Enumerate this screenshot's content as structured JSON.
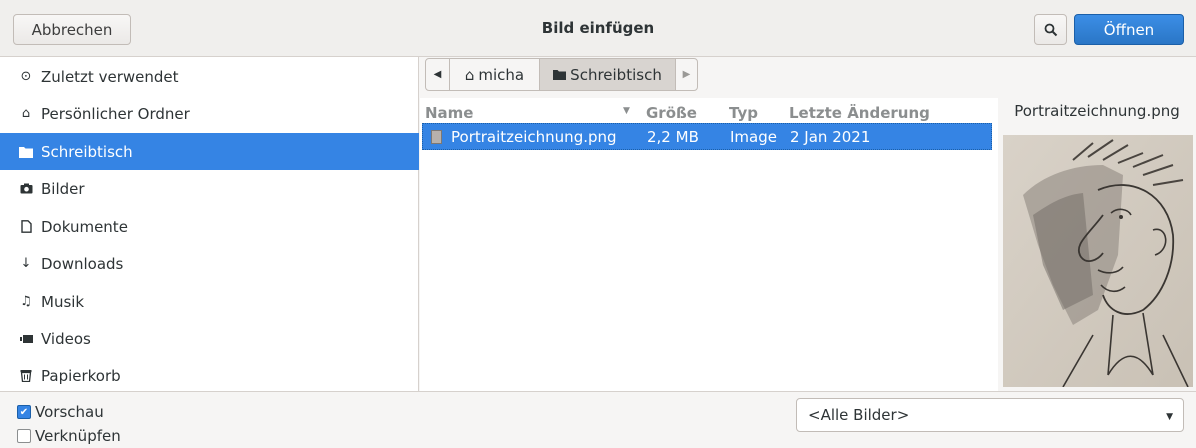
{
  "header": {
    "cancel_label": "Abbrechen",
    "title": "Bild einfügen",
    "open_label": "Öffnen"
  },
  "sidebar": {
    "items": [
      {
        "label": "Zuletzt verwendet",
        "icon": "clock-icon",
        "active": false
      },
      {
        "label": "Persönlicher Ordner",
        "icon": "home-icon",
        "active": false
      },
      {
        "label": "Schreibtisch",
        "icon": "folder-icon",
        "active": true
      },
      {
        "label": "Bilder",
        "icon": "camera-icon",
        "active": false
      },
      {
        "label": "Dokumente",
        "icon": "document-icon",
        "active": false
      },
      {
        "label": "Downloads",
        "icon": "download-icon",
        "active": false
      },
      {
        "label": "Musik",
        "icon": "music-icon",
        "active": false
      },
      {
        "label": "Videos",
        "icon": "video-icon",
        "active": false
      },
      {
        "label": "Papierkorb",
        "icon": "trash-icon",
        "active": false
      }
    ]
  },
  "pathbar": {
    "segments": [
      "micha",
      "Schreibtisch"
    ]
  },
  "filelist": {
    "columns": [
      "Name",
      "Größe",
      "Typ",
      "Letzte Änderung"
    ],
    "rows": [
      {
        "name": "Portraitzeichnung.png",
        "size": "2,2 MB",
        "type": "Image",
        "modified": "2 Jan 2021",
        "selected": true
      }
    ]
  },
  "preview": {
    "filename": "Portraitzeichnung.png"
  },
  "bottom": {
    "preview_checkbox": {
      "label": "Vorschau",
      "checked": true
    },
    "link_checkbox": {
      "label": "Verknüpfen",
      "checked": false
    },
    "filter": "<Alle Bilder>"
  },
  "colors": {
    "accent": "#3584e4",
    "background": "#f6f5f4"
  }
}
